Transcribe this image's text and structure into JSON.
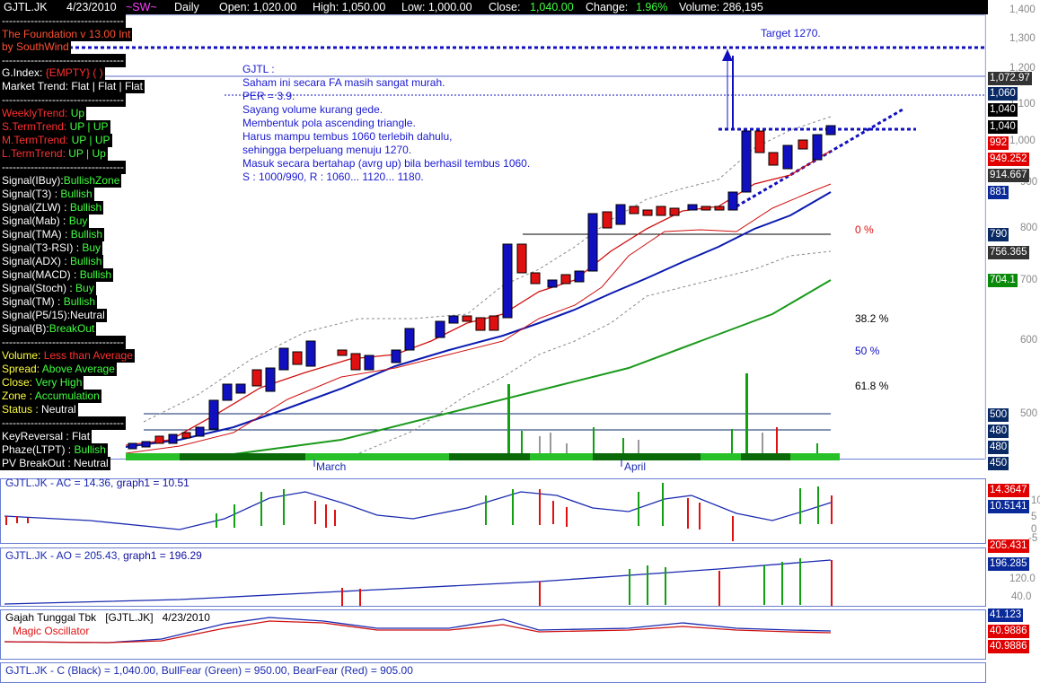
{
  "topbar": {
    "symbol": "GJTL.JK",
    "date": "4/23/2010",
    "sw": "~SW~",
    "period": "Daily",
    "open": "Open: 1,020.00",
    "high": "High: 1,050.00",
    "low": "Low: 1,000.00",
    "close_label": "Close:",
    "close_value": "1,040.00",
    "change_label": "Change:",
    "change_value": "1.96%",
    "volume": "Volume: 286,195"
  },
  "left_panel": {
    "dashes": "----------------------------------",
    "foundation": "The Foundation v 13.00 Int",
    "author": "by SouthWind",
    "gindex_label": "G.Index:",
    "gindex_value": "{EMPTY} ( )",
    "market_trend": "Market Trend: Flat | Flat | Flat",
    "weekly_label": "WeeklyTrend:",
    "weekly_value": "Up",
    "sterm_label": "S.TermTrend:",
    "sterm_value": "UP | UP",
    "mterm_label": "M.TermTrend:",
    "mterm_value": "UP | UP",
    "lterm_label": "L.TermTrend:",
    "lterm_value": "UP | Up",
    "signals": [
      {
        "label": "Signal(IBuy):",
        "value": "BullishZone"
      },
      {
        "label": "Signal(T3)   :",
        "value": "Bullish"
      },
      {
        "label": "Signal(ZLW)  :",
        "value": "Bullish"
      },
      {
        "label": "Signal(Mab)  :",
        "value": "Buy"
      },
      {
        "label": "Signal(TMA)  :",
        "value": "Bullish"
      },
      {
        "label": "Signal(T3-RSI) :",
        "value": "Buy"
      },
      {
        "label": "Signal(ADX)  :",
        "value": "Bullish"
      },
      {
        "label": "Signal(MACD) :",
        "value": "Bullish"
      },
      {
        "label": "Signal(Stoch) :",
        "value": "Buy"
      },
      {
        "label": "Signal(TM) :",
        "value": "Bullish"
      },
      {
        "label": "Signal(P5/15):",
        "value": "Neutral"
      },
      {
        "label": "Signal(B):",
        "value": "BreakOut"
      }
    ],
    "volume_label": "Volume:",
    "volume_value": "Less than Average",
    "spread_label": "Spread:",
    "spread_value": "Above Average",
    "close_label": "Close:",
    "close_value": "Very High",
    "zone_label": "Zone :",
    "zone_value": "Accumulation",
    "status_label": "Status :",
    "status_value": "Neutral",
    "keyreversal": "KeyReversal : Flat",
    "phaze_label": "Phaze(LTPT) :",
    "phaze_value": "Bullish",
    "pvbreakout": "PV BreakOut : Neutral"
  },
  "annotation": {
    "lines": [
      "GJTL :",
      "Saham ini secara FA masih sangat murah.",
      "PER = 3.9.",
      "Sayang volume kurang gede.",
      "Membentuk pola ascending triangle.",
      "Harus mampu tembus 1060 terlebih dahulu,",
      "sehingga berpeluang menuju 1270.",
      "Masuk secara bertahap (avrg up) bila berhasil tembus 1060.",
      "S : 1000/990, R : 1060... 1120... 1180."
    ],
    "target": "Target 1270."
  },
  "fibo": {
    "zero": "0 %",
    "f382": "38.2 %",
    "f50": "50 %",
    "f618": "61.8 %"
  },
  "months": {
    "march": "March",
    "april": "April"
  },
  "price_axis": {
    "ticks": [
      "1,400",
      "1,300",
      "1,200",
      "1,100",
      "1,000",
      "900",
      "800",
      "700",
      "600",
      "500",
      "450"
    ],
    "tags": [
      {
        "text": "1,072.97",
        "bg": "#333333",
        "fg": "#ffffff"
      },
      {
        "text": "1,060",
        "bg": "#0a2a66",
        "fg": "#ffffff"
      },
      {
        "text": "1,040",
        "bg": "#000000",
        "fg": "#ffffff"
      },
      {
        "text": "1,040",
        "bg": "#000000",
        "fg": "#ffffff"
      },
      {
        "text": "992",
        "bg": "#e00000",
        "fg": "#ffffff"
      },
      {
        "text": "949.252",
        "bg": "#e00000",
        "fg": "#ffffff"
      },
      {
        "text": "914.667",
        "bg": "#333333",
        "fg": "#ffffff"
      },
      {
        "text": "881",
        "bg": "#0a2a9a",
        "fg": "#ffffff"
      },
      {
        "text": "790",
        "bg": "#0a2a66",
        "fg": "#ffffff"
      },
      {
        "text": "756.365",
        "bg": "#333333",
        "fg": "#ffffff"
      },
      {
        "text": "704.1",
        "bg": "#0a8a0a",
        "fg": "#ffffff"
      },
      {
        "text": "500",
        "bg": "#0a2a66",
        "fg": "#ffffff"
      },
      {
        "text": "480",
        "bg": "#0a2a66",
        "fg": "#ffffff"
      },
      {
        "text": "480",
        "bg": "#0a2a66",
        "fg": "#ffffff"
      },
      {
        "text": "450",
        "bg": "#0a2a66",
        "fg": "#ffffff"
      }
    ]
  },
  "ac_panel": {
    "title": "GJTL.JK - AC = 14.36,",
    "graph": "graph1 = 10.51",
    "tag1": "14.3647",
    "tag2": "10.5141",
    "ticks": [
      "10",
      "5",
      "0",
      "-5",
      "-6"
    ]
  },
  "ao_panel": {
    "title": "GJTL.JK - AO = 205.43,",
    "graph": "graph1 = 196.29",
    "tag1": "205.431",
    "tag2": "196.285",
    "ticks": [
      "120.0",
      "40.0",
      "0.0"
    ]
  },
  "mo_panel": {
    "name": "Gajah Tunggal Tbk",
    "symbol": "[GJTL.JK]",
    "date": "4/23/2010",
    "title": "Magic Oscillator",
    "tag1": "41.123",
    "tag2": "40.9886",
    "tag3": "40.9886"
  },
  "bottom_panel": {
    "title": "GJTL.JK - C (Black) = 1,040.00, BullFear (Green) = 950.00, BearFear (Red) = 905.00"
  }
}
